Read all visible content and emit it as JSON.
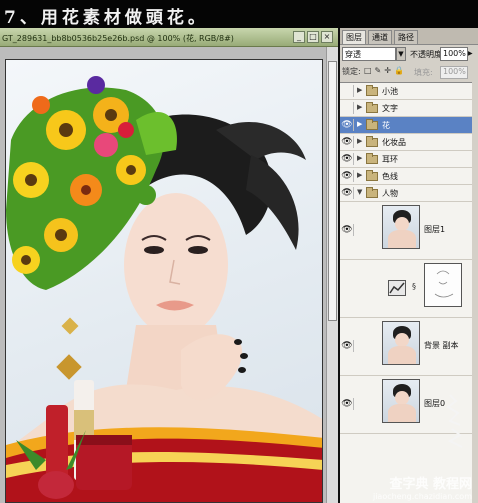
{
  "step_title": "7、用花素材做頭花。",
  "document": {
    "title": "GT_289631_bb8b0536b25e26b.psd @ 100% (花, RGB/8#)",
    "minimize": "_",
    "maximize": "□",
    "close": "×"
  },
  "panel": {
    "tabs": [
      "图层",
      "通道",
      "路径"
    ],
    "blend_mode": "穿透",
    "blend_arrow": "▼",
    "opacity_label": "不透明度:",
    "opacity_value": "100%",
    "opacity_arrow": "▶",
    "lock_label": "锁定:",
    "lock_icons": "□✎✛🔒",
    "fill_label": "填充:",
    "fill_value": "100%"
  },
  "layers": [
    {
      "name": "小池",
      "visible": false,
      "expanded": false,
      "selected": false
    },
    {
      "name": "文字",
      "visible": false,
      "expanded": false,
      "selected": false
    },
    {
      "name": "花",
      "visible": true,
      "expanded": false,
      "selected": true
    },
    {
      "name": "化妆品",
      "visible": true,
      "expanded": false,
      "selected": false
    },
    {
      "name": "耳环",
      "visible": true,
      "expanded": false,
      "selected": false
    },
    {
      "name": "色线",
      "visible": true,
      "expanded": false,
      "selected": false
    },
    {
      "name": "人物",
      "visible": true,
      "expanded": true,
      "selected": false
    }
  ],
  "image_layers": [
    {
      "name": "图层1"
    },
    {
      "name": "背景 副本"
    },
    {
      "name": "图层0"
    }
  ],
  "watermark": {
    "text": "查字典 教程网",
    "url": "jiaocheng.chazidian.com"
  },
  "colors": {
    "selected_layer": "#5a82c4",
    "panel_bg": "#d4d0c8",
    "title_bar": "#98ab77"
  }
}
